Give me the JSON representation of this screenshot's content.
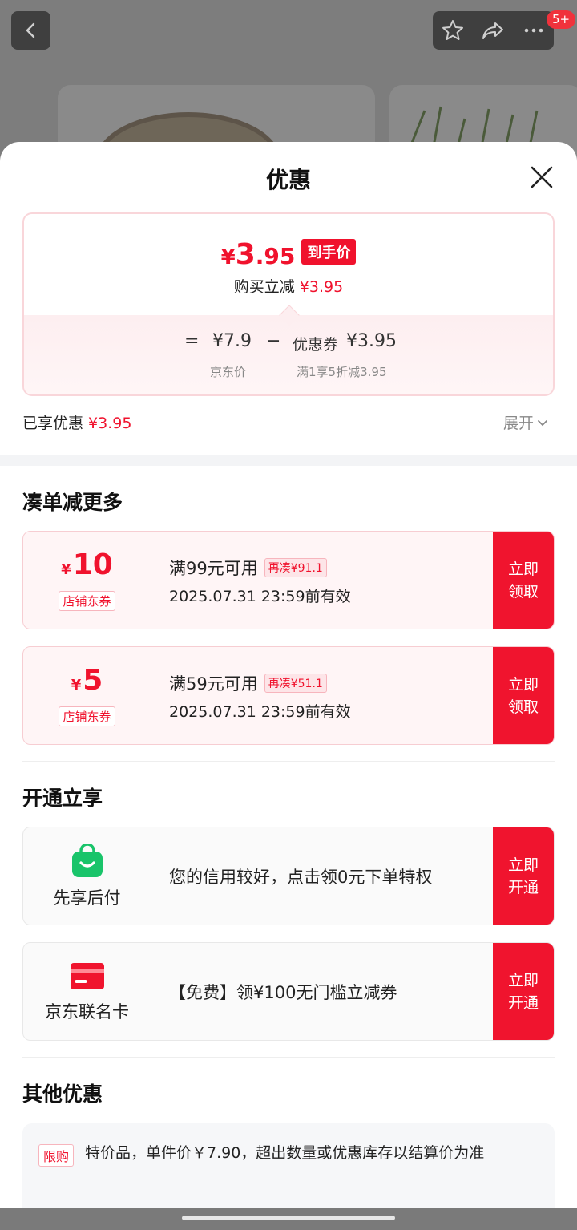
{
  "background": {
    "badge": "5+"
  },
  "sheet": {
    "title": "优惠",
    "final_price_yen": "¥",
    "final_price_int": "3",
    "final_price_dec": ".95",
    "final_tag": "到手价",
    "reduce_label": "购买立减",
    "reduce_value": "¥3.95",
    "formula": {
      "eq": "=",
      "jd_price": "¥7.9",
      "minus": "−",
      "coupon_label": "优惠券",
      "coupon_value": "¥3.95",
      "jd_price_caption": "京东价",
      "coupon_caption": "满1享5折减3.95"
    },
    "enjoyed_label": "已享优惠",
    "enjoyed_value": "¥3.95",
    "expand_label": "展开"
  },
  "section_more": {
    "title": "凑单减更多",
    "coupons": [
      {
        "yen": "¥",
        "amount": "10",
        "tag": "店铺东券",
        "condition": "满99元可用",
        "more": "再凑¥91.1",
        "valid": "2025.07.31 23:59前有效",
        "button": "立即领取"
      },
      {
        "yen": "¥",
        "amount": "5",
        "tag": "店铺东券",
        "condition": "满59元可用",
        "more": "再凑¥51.1",
        "valid": "2025.07.31 23:59前有效",
        "button": "立即领取"
      }
    ]
  },
  "section_open": {
    "title": "开通立享",
    "items": [
      {
        "icon": "shopping-bag-icon",
        "name": "先享后付",
        "desc": "您的信用较好，点击领0元下单特权",
        "button": "立即开通",
        "color": "#19c46a"
      },
      {
        "icon": "credit-card-icon",
        "name": "京东联名卡",
        "desc": "【免费】领¥100无门槛立减券",
        "button": "立即开通",
        "color": "#f0142e"
      }
    ]
  },
  "section_other": {
    "title": "其他优惠",
    "tag": "限购",
    "text": "特价品，单件价￥7.90，超出数量或优惠库存以结算价为准"
  },
  "colors": {
    "accent": "#f0122d",
    "button": "#f0142e",
    "coupon_bg": "#fff5f6"
  }
}
